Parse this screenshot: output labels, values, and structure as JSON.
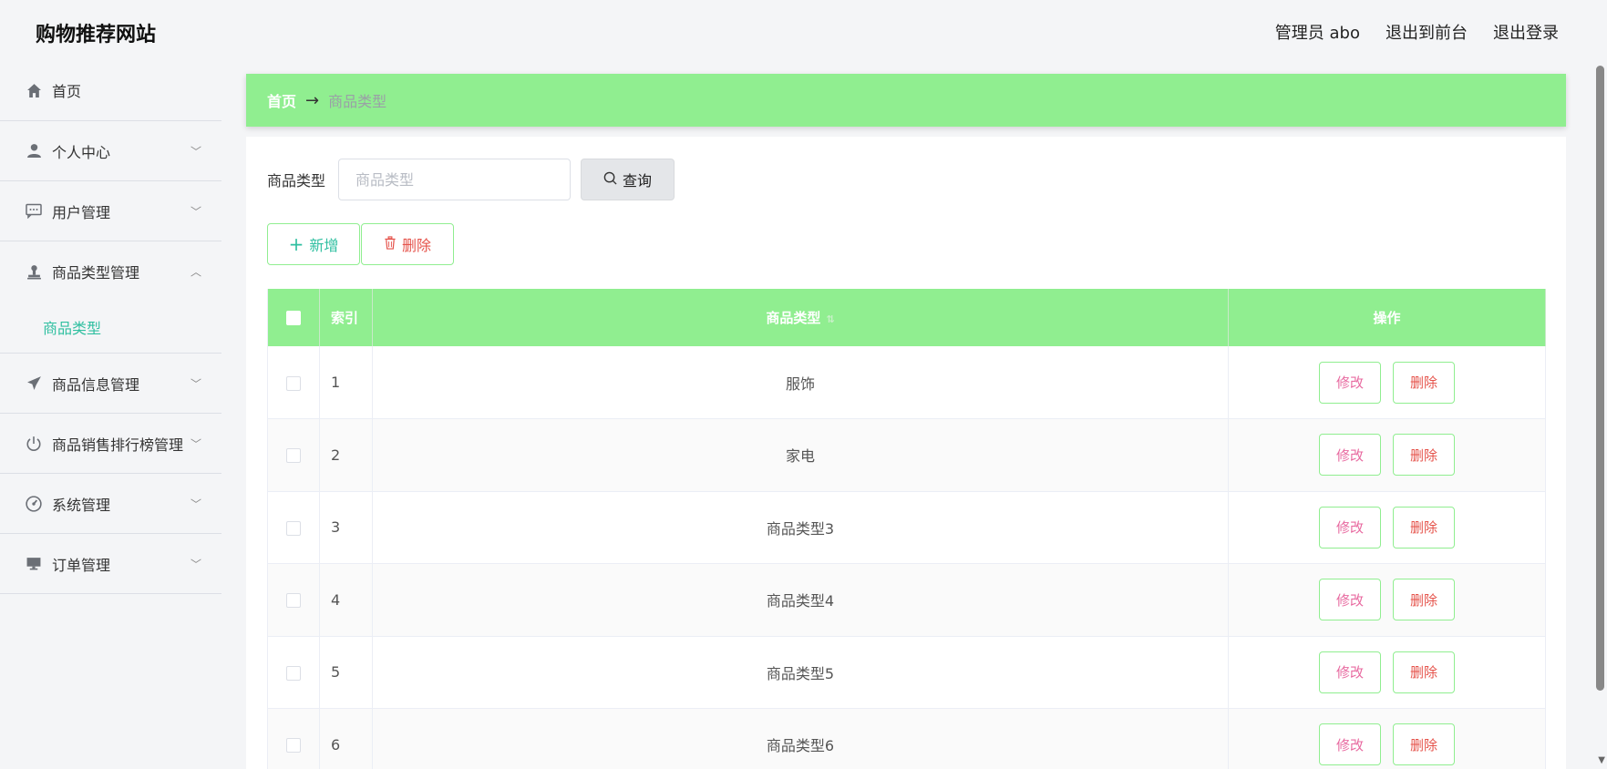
{
  "header": {
    "brand": "购物推荐网站",
    "admin": "管理员 abo",
    "to_front": "退出到前台",
    "logout": "退出登录"
  },
  "sidebar": {
    "items": [
      {
        "label": "首页",
        "icon": "home-icon"
      },
      {
        "label": "个人中心",
        "icon": "user-icon"
      },
      {
        "label": "用户管理",
        "icon": "chat-icon"
      },
      {
        "label": "商品类型管理",
        "icon": "stamp-icon"
      },
      {
        "label": "商品信息管理",
        "icon": "send-icon"
      },
      {
        "label": "商品销售排行榜管理",
        "icon": "power-icon"
      },
      {
        "label": "系统管理",
        "icon": "gauge-icon"
      },
      {
        "label": "订单管理",
        "icon": "monitor-icon"
      }
    ],
    "submenu": {
      "label": "商品类型"
    }
  },
  "breadcrumb": {
    "home": "首页",
    "current": "商品类型"
  },
  "search": {
    "label": "商品类型",
    "placeholder": "商品类型",
    "value": "",
    "button": "查询"
  },
  "actions": {
    "add": "新增",
    "delete": "删除"
  },
  "table": {
    "columns": [
      "索引",
      "商品类型",
      "操作"
    ],
    "rows": [
      {
        "index": "1",
        "type": "服饰"
      },
      {
        "index": "2",
        "type": "家电"
      },
      {
        "index": "3",
        "type": "商品类型3"
      },
      {
        "index": "4",
        "type": "商品类型4"
      },
      {
        "index": "5",
        "type": "商品类型5"
      },
      {
        "index": "6",
        "type": "商品类型6"
      }
    ],
    "edit_label": "修改",
    "delete_label": "删除"
  },
  "colors": {
    "accent_green": "#90ee90",
    "teal": "#2fbfa0",
    "danger": "#e5534b",
    "edit_pink": "#e86aa0"
  }
}
